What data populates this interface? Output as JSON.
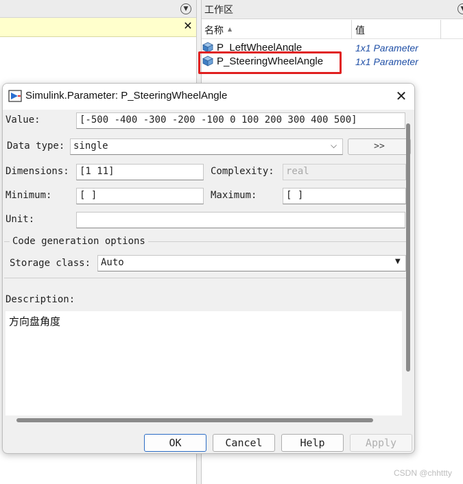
{
  "workspace": {
    "title": "工作区",
    "columns": {
      "name": "名称",
      "name_sort_glyph": "▲",
      "value": "值"
    },
    "rows": [
      {
        "name": "P_LeftWheelAngle",
        "value": "1x1 Parameter",
        "icon": "parameter-cube-icon"
      },
      {
        "name": "P_SteeringWheelAngle",
        "value": "1x1 Parameter",
        "icon": "parameter-cube-icon",
        "highlighted": true
      }
    ],
    "collapse_glyph": "▼"
  },
  "left_pane": {
    "collapse_glyph": "▼",
    "banner_close": "✕"
  },
  "dialog": {
    "title": "Simulink.Parameter: P_SteeringWheelAngle",
    "close_glyph": "✕",
    "value_label": "Value:",
    "value": "[-500 -400 -300 -200 -100 0 100 200 300 400 500]",
    "data_type_label": "Data type:",
    "data_type": "single",
    "data_type_more": ">>",
    "dimensions_label": "Dimensions:",
    "dimensions": "[1 11]",
    "complexity_label": "Complexity:",
    "complexity": "real",
    "minimum_label": "Minimum:",
    "minimum": "[ ]",
    "maximum_label": "Maximum:",
    "maximum": "[ ]",
    "unit_label": "Unit:",
    "unit": "",
    "codegen_title": "Code generation options",
    "storage_class_label": "Storage class:",
    "storage_class": "Auto",
    "description_label": "Description:",
    "description": "方向盘角度",
    "buttons": {
      "ok": "OK",
      "cancel": "Cancel",
      "help": "Help",
      "apply": "Apply"
    },
    "colors": {
      "highlight_border": "#e02020",
      "ok_border": "#2b6cc4",
      "value_text": "#1f4fa6"
    }
  },
  "watermark": "CSDN @chhttty"
}
